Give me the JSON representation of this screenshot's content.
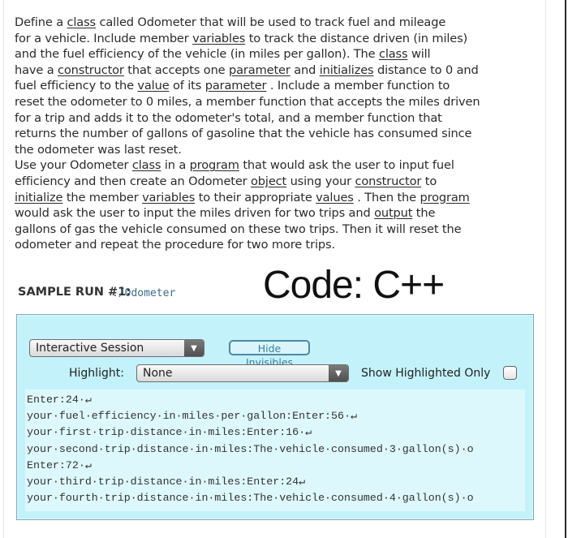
{
  "problem": {
    "paragraph1": [
      {
        "t": "Define a "
      },
      {
        "t": "class",
        "u": true
      },
      {
        "t": "  called Odometer that will be used to track fuel and mileage"
      },
      {
        "br": true
      },
      {
        "t": "for a vehicle. Include member "
      },
      {
        "t": "variables",
        "u": true
      },
      {
        "t": "  to track the distance driven (in miles)"
      },
      {
        "br": true
      },
      {
        "t": "and the fuel efficiency of the vehicle (in miles per gallon). The "
      },
      {
        "t": "class",
        "u": true
      },
      {
        "t": "  will"
      },
      {
        "br": true
      },
      {
        "t": "have a "
      },
      {
        "t": "constructor",
        "u": true
      },
      {
        "t": "  that accepts one "
      },
      {
        "t": "parameter",
        "u": true
      },
      {
        "t": "  and "
      },
      {
        "t": "initializes",
        "u": true
      },
      {
        "t": "  distance to 0 and"
      },
      {
        "br": true
      },
      {
        "t": "fuel efficiency to the "
      },
      {
        "t": "value",
        "u": true
      },
      {
        "t": "  of its "
      },
      {
        "t": "parameter",
        "u": true
      },
      {
        "t": " . Include a member function to"
      },
      {
        "br": true
      },
      {
        "t": "reset the odometer to 0 miles, a member function that accepts the miles driven"
      },
      {
        "br": true
      },
      {
        "t": "for a trip and adds it to the odometer's total, and a member function that"
      },
      {
        "br": true
      },
      {
        "t": "returns the number of gallons of gasoline that the vehicle has consumed since"
      },
      {
        "br": true
      },
      {
        "t": "the odometer was last reset."
      }
    ],
    "paragraph2": [
      {
        "t": "Use your Odometer "
      },
      {
        "t": "class",
        "u": true
      },
      {
        "t": "  in a "
      },
      {
        "t": "program",
        "u": true
      },
      {
        "t": "  that would ask the user to input fuel"
      },
      {
        "br": true
      },
      {
        "t": "efficiency and then create an Odometer "
      },
      {
        "t": "object",
        "u": true
      },
      {
        "t": "  using your "
      },
      {
        "t": "constructor",
        "u": true
      },
      {
        "t": "  to"
      },
      {
        "br": true
      },
      {
        "t": "initialize",
        "u": true
      },
      {
        "t": "  the member "
      },
      {
        "t": "variables",
        "u": true
      },
      {
        "t": "  to their appropriate "
      },
      {
        "t": "values",
        "u": true
      },
      {
        "t": " . Then the "
      },
      {
        "t": "program",
        "u": true
      },
      {
        "br": true
      },
      {
        "t": "would ask the user to input the miles driven for two trips and "
      },
      {
        "t": "output",
        "u": true
      },
      {
        "t": "  the"
      },
      {
        "br": true
      },
      {
        "t": "gallons of gas the vehicle consumed on these two trips. Then it will reset the"
      },
      {
        "br": true
      },
      {
        "t": "odometer and repeat the procedure for two more trips."
      }
    ]
  },
  "sample": {
    "label": "SAMPLE RUN #1:",
    "command": "./Odometer",
    "code_title": "Code: C++"
  },
  "session": {
    "mode_select": "Interactive Session",
    "hide_invisibles": "Hide Invisibles",
    "highlight_label": "Highlight:",
    "highlight_select": "None",
    "show_highlighted_label": "Show Highlighted Only",
    "show_highlighted_checked": false,
    "dropdown_arrow": "▼",
    "output_lines": [
      "Enter:24·↵",
      "your·fuel·efficiency·in·miles·per·gallon:Enter:56·↵",
      "your·first·trip·distance·in·miles:Enter:16·↵",
      "your·second·trip·distance·in·miles:The·vehicle·consumed·3·gallon(s)·o",
      "Enter:72·↵",
      "your·third·trip·distance·in·miles:Enter:24↵",
      "your·fourth·trip·distance·in·miles:The·vehicle·consumed·4·gallon(s)·o"
    ]
  }
}
